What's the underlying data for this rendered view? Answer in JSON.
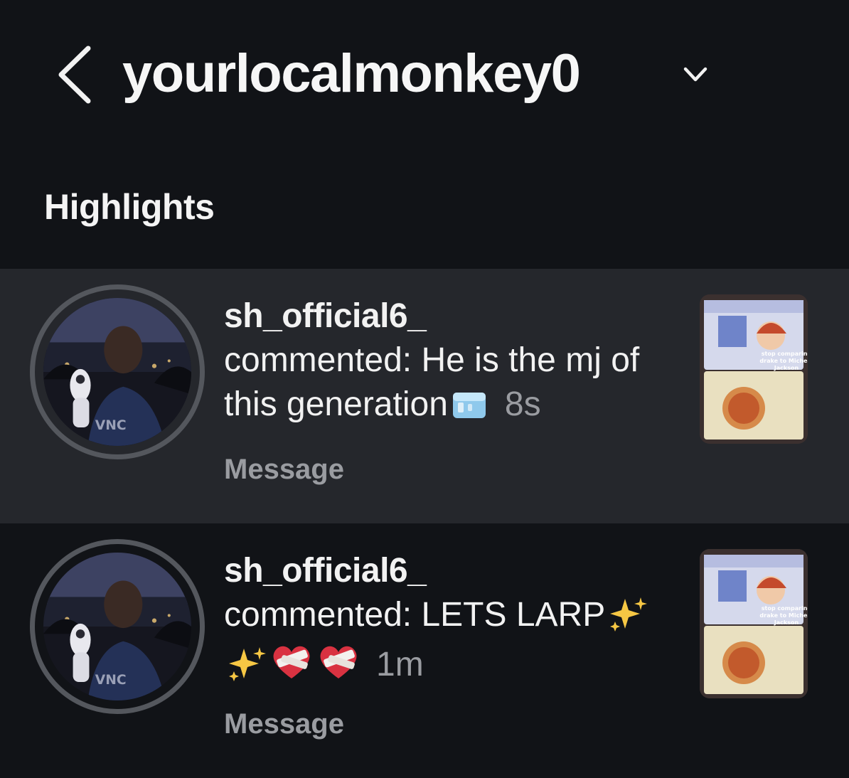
{
  "header": {
    "title": "yourlocalmonkey0"
  },
  "section_title": "Highlights",
  "notifications": [
    {
      "username": "sh_official6_",
      "text": "commented: He is the mj of this generation",
      "emoji": [
        "ice-cube"
      ],
      "time": "8s",
      "action": "Message",
      "thumbnail_caption": "stop comparing drake to Micheal Jackson",
      "highlighted": true
    },
    {
      "username": "sh_official6_",
      "text": "commented: LETS LARP",
      "emoji": [
        "sparkles",
        "sparkles",
        "mending-heart",
        "mending-heart"
      ],
      "time": "1m",
      "action": "Message",
      "thumbnail_caption": "stop comparing drake to Micheal Jackson",
      "highlighted": false
    }
  ],
  "colors": {
    "background": "#111317",
    "highlight_row": "#25272c",
    "secondary_text": "#9a9ca1",
    "primary_text": "#f2f2f2"
  }
}
